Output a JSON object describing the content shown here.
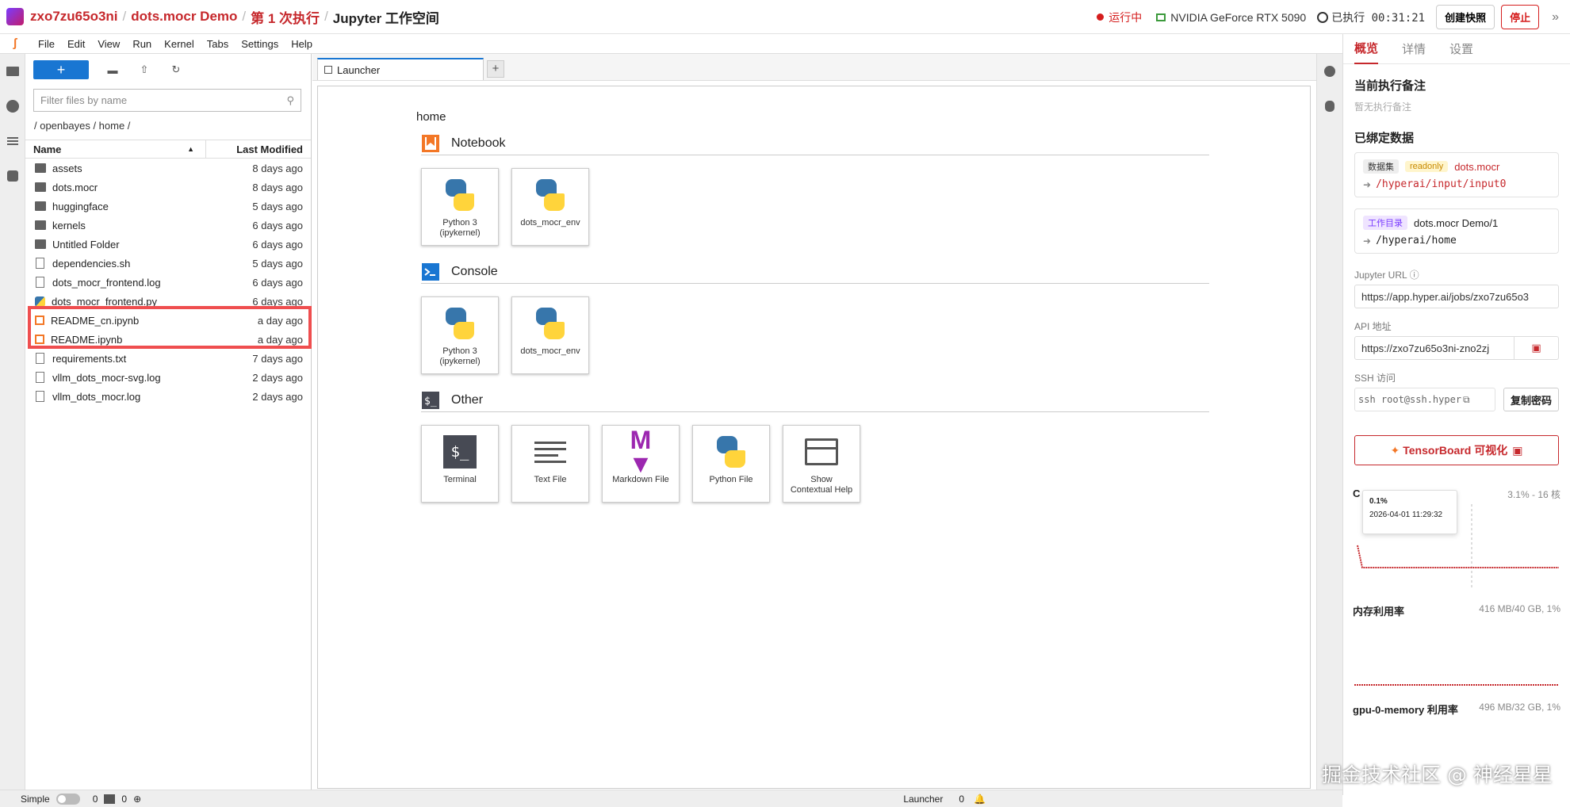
{
  "header": {
    "crumbs": [
      "zxo7zu65o3ni",
      "dots.mocr Demo",
      "第 1 次执行",
      "Jupyter 工作空间"
    ],
    "status": "运行中",
    "gpu": "NVIDIA GeForce RTX 5090",
    "exec_time": "已执行 00:31:21",
    "snapshot_btn": "创建快照",
    "stop_btn": "停止",
    "collapse": "»"
  },
  "menu": [
    "File",
    "Edit",
    "View",
    "Run",
    "Kernel",
    "Tabs",
    "Settings",
    "Help"
  ],
  "filebrowser": {
    "new_btn": "+",
    "filter_placeholder": "Filter files by name",
    "path": "/ openbayes / home /",
    "col_name": "Name",
    "col_modified": "Last Modified",
    "files": [
      {
        "name": "assets",
        "modified": "8 days ago",
        "icon": "folder-icon"
      },
      {
        "name": "dots.mocr",
        "modified": "8 days ago",
        "icon": "folder-icon"
      },
      {
        "name": "huggingface",
        "modified": "5 days ago",
        "icon": "folder-icon"
      },
      {
        "name": "kernels",
        "modified": "6 days ago",
        "icon": "folder-icon"
      },
      {
        "name": "Untitled Folder",
        "modified": "6 days ago",
        "icon": "folder-icon"
      },
      {
        "name": "dependencies.sh",
        "modified": "5 days ago",
        "icon": "file-icon"
      },
      {
        "name": "dots_mocr_frontend.log",
        "modified": "6 days ago",
        "icon": "file-icon"
      },
      {
        "name": "dots_mocr_frontend.py",
        "modified": "6 days ago",
        "icon": "python-file-icon"
      },
      {
        "name": "README_cn.ipynb",
        "modified": "a day ago",
        "icon": "notebook-icon"
      },
      {
        "name": "README.ipynb",
        "modified": "a day ago",
        "icon": "notebook-icon"
      },
      {
        "name": "requirements.txt",
        "modified": "7 days ago",
        "icon": "file-icon"
      },
      {
        "name": "vllm_dots_mocr-svg.log",
        "modified": "2 days ago",
        "icon": "file-icon"
      },
      {
        "name": "vllm_dots_mocr.log",
        "modified": "2 days ago",
        "icon": "file-icon"
      }
    ]
  },
  "tab": {
    "label": "Launcher",
    "add": "+"
  },
  "launcher": {
    "home": "home",
    "sections": {
      "notebook": {
        "title": "Notebook",
        "cards": [
          {
            "label": "Python 3\n(ipykernel)"
          },
          {
            "label": "dots_mocr_env"
          }
        ]
      },
      "console": {
        "title": "Console",
        "cards": [
          {
            "label": "Python 3\n(ipykernel)"
          },
          {
            "label": "dots_mocr_env"
          }
        ]
      },
      "other": {
        "title": "Other",
        "cards": [
          {
            "label": "Terminal"
          },
          {
            "label": "Text File"
          },
          {
            "label": "Markdown File"
          },
          {
            "label": "Python File"
          },
          {
            "label": "Show\nContextual Help"
          }
        ]
      }
    }
  },
  "rpanel": {
    "tabs": [
      "概览",
      "详情",
      "设置"
    ],
    "current_note_title": "当前执行备注",
    "current_note_empty": "暂无执行备注",
    "bound_title": "已绑定数据",
    "dataset_tag": "数据集",
    "readonly_tag": "readonly",
    "dataset_name": "dots.mocr",
    "dataset_path": "/hyperai/input/input0",
    "workdir_tag": "工作目录",
    "workdir_name": "dots.mocr Demo/1",
    "workdir_path": "/hyperai/home",
    "jupyter_label": "Jupyter URL",
    "jupyter_value": "https://app.hyper.ai/jobs/zxo7zu65o3",
    "api_label": "API 地址",
    "api_value": "https://zxo7zu65o3ni-zno2zj",
    "ssh_label": "SSH 访问",
    "ssh_value": "ssh root@ssh.hyper",
    "copy_pwd": "复制密码",
    "tensorboard": "TensorBoard 可视化",
    "gpu_metric": {
      "title": "C",
      "value": "3.1% - 16 核",
      "tooltip_value": "0.1%",
      "tooltip_time": "2026-04-01 11:29:32"
    },
    "mem_metric": {
      "title": "内存利用率",
      "value": "416 MB/40 GB, 1%"
    },
    "gpu_mem_metric": {
      "title": "gpu-0-memory 利用率",
      "value": "496 MB/32 GB, 1%"
    }
  },
  "statusbar": {
    "mode": "Simple",
    "n1": "0",
    "n2": "0",
    "right_label": "Launcher",
    "right_count": "0"
  },
  "watermark": "掘金技术社区 @ 神经星星"
}
